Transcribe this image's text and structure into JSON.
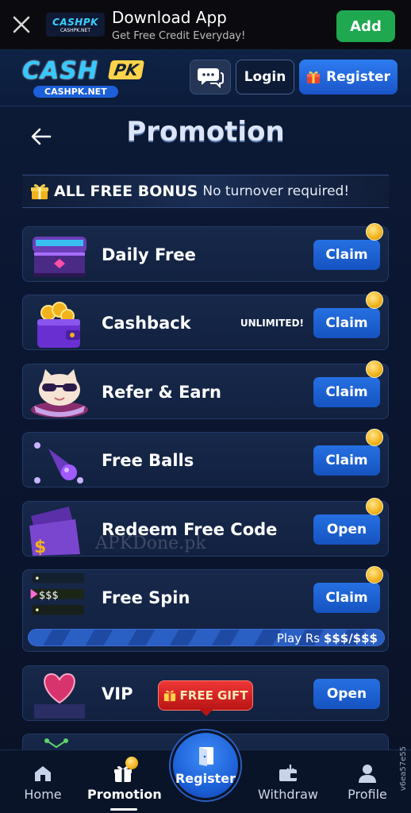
{
  "download_bar": {
    "title": "Download App",
    "subtitle": "Get Free Credit Everyday!",
    "add_label": "Add",
    "logo_top": "CASHPK",
    "logo_bottom": "CASHPK.NET"
  },
  "header": {
    "brand_cash": "CASH",
    "brand_pk": "PK",
    "brand_domain": "CASHPK.NET",
    "login_label": "Login",
    "register_label": "Register"
  },
  "page": {
    "title": "Promotion",
    "bonus_bold": "ALL FREE BONUS",
    "bonus_light": "No turnover required!"
  },
  "promotions": [
    {
      "label": "Daily Free",
      "action": "Claim",
      "icon": "treasure-chest-icon"
    },
    {
      "label": "Cashback",
      "tag": "UNLIMITED!",
      "action": "Claim",
      "icon": "wallet-coins-icon"
    },
    {
      "label": "Refer & Earn",
      "action": "Claim",
      "icon": "cat-mascot-icon"
    },
    {
      "label": "Free Balls",
      "action": "Claim",
      "icon": "comet-ball-icon"
    },
    {
      "label": "Redeem Free Code",
      "action": "Open",
      "icon": "coupon-ticket-icon"
    },
    {
      "label": "Free Spin",
      "action": "Claim",
      "icon": "spin-ticket-icon",
      "ticket_text": "$$$",
      "progress_prefix": "Play Rs",
      "progress_value": "$$$/$$$"
    },
    {
      "label": "VIP",
      "action": "Open",
      "icon": "heart-trophy-icon"
    }
  ],
  "gift_badge": "FREE GIFT",
  "watermark": "APKDone.pk",
  "side_id": "v6ea57e55",
  "bottom_nav": {
    "home": "Home",
    "promotion": "Promotion",
    "register": "Register",
    "withdraw": "Withdraw",
    "profile": "Profile"
  },
  "colors": {
    "accent_blue": "#1a55c9",
    "add_green": "#1fa84f",
    "coin_gold": "#f2b21c",
    "gift_red": "#d22020"
  }
}
